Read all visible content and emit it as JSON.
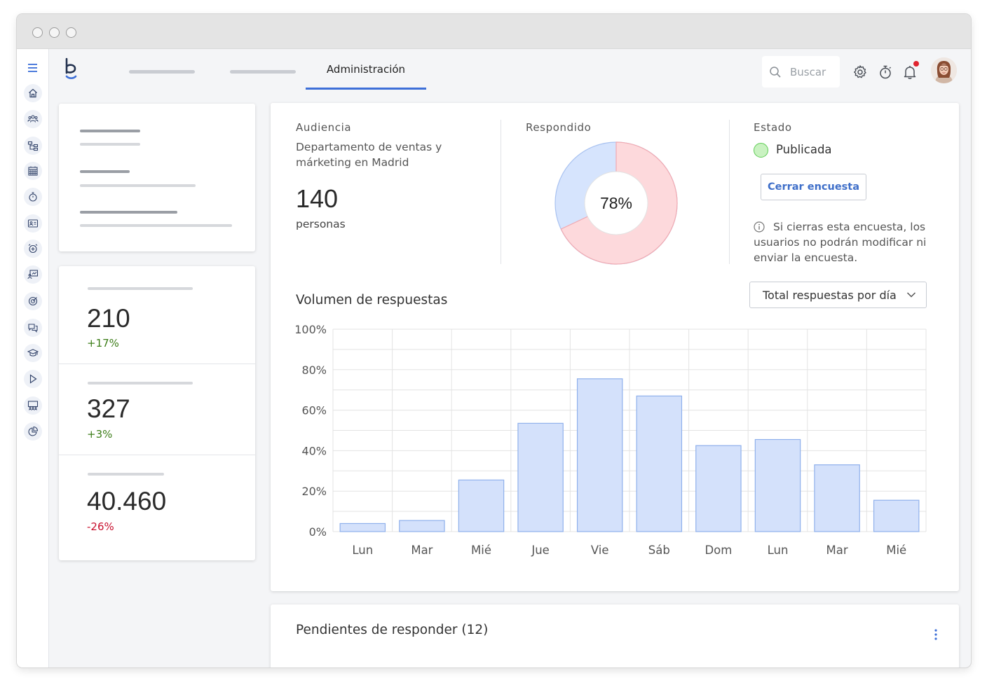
{
  "window": {
    "title": ""
  },
  "topnav": {
    "tabs": [
      {
        "label": ""
      },
      {
        "label": ""
      },
      {
        "label": "Administración",
        "active": true
      }
    ],
    "search": {
      "placeholder": "Buscar"
    },
    "icons": [
      "gear-icon",
      "stopwatch-icon",
      "bell-icon"
    ],
    "has_notification": true
  },
  "sidebar": {
    "icons": [
      "menu-icon",
      "home-icon",
      "people-icon",
      "org-chart-icon",
      "calendar-icon",
      "stopwatch-icon",
      "id-card-icon",
      "alarm-clock-icon",
      "presentation-icon",
      "target-icon",
      "chat-icon",
      "graduation-cap-icon",
      "play-icon",
      "team-board-icon",
      "pie-chart-icon"
    ]
  },
  "stats": [
    {
      "value": "210",
      "delta": "+17%",
      "trend": "up"
    },
    {
      "value": "327",
      "delta": "+3%",
      "trend": "up"
    },
    {
      "value": "40.460",
      "delta": "-26%",
      "trend": "down"
    }
  ],
  "survey": {
    "audience": {
      "label": "Audiencia",
      "description": "Departamento de ventas y márketing en Madrid",
      "count": "140",
      "unit": "personas"
    },
    "responded": {
      "label": "Respondido",
      "percent_label": "78%",
      "donut_fraction": 0.68
    },
    "status": {
      "label": "Estado",
      "value": "Publicada",
      "close_button": "Cerrar encuesta",
      "info_text": "Si cierras esta encuesta, los usuarios no podrán modificar ni enviar la encuesta."
    }
  },
  "volume": {
    "title": "Volumen de respuestas",
    "dropdown_value": "Total respuestas por día"
  },
  "chart_data": {
    "type": "bar",
    "title": "Volumen de respuestas",
    "categories": [
      "Lun",
      "Mar",
      "Mié",
      "Jue",
      "Vie",
      "Sáb",
      "Dom",
      "Lun",
      "Mar",
      "Mié"
    ],
    "values": [
      4,
      5.5,
      25.5,
      53.5,
      75.5,
      67,
      42.5,
      45.5,
      33,
      15.5
    ],
    "ylim": [
      0,
      100
    ],
    "yticks": [
      "0%",
      "20%",
      "40%",
      "60%",
      "80%",
      "100%"
    ],
    "grid": true,
    "colors": {
      "bar_fill": "#d4e1fb",
      "bar_stroke": "#8fb0ec",
      "grid": "#e3e3e3"
    }
  },
  "pending": {
    "title": "Pendientes de responder (12)"
  },
  "colors": {
    "accent": "#3d6fd8",
    "positive": "#3c7d18",
    "negative": "#c8102e",
    "donut_blue": "#d6e4fd",
    "donut_pink": "#fdd9dc",
    "status_green": "#c9f2c1"
  }
}
